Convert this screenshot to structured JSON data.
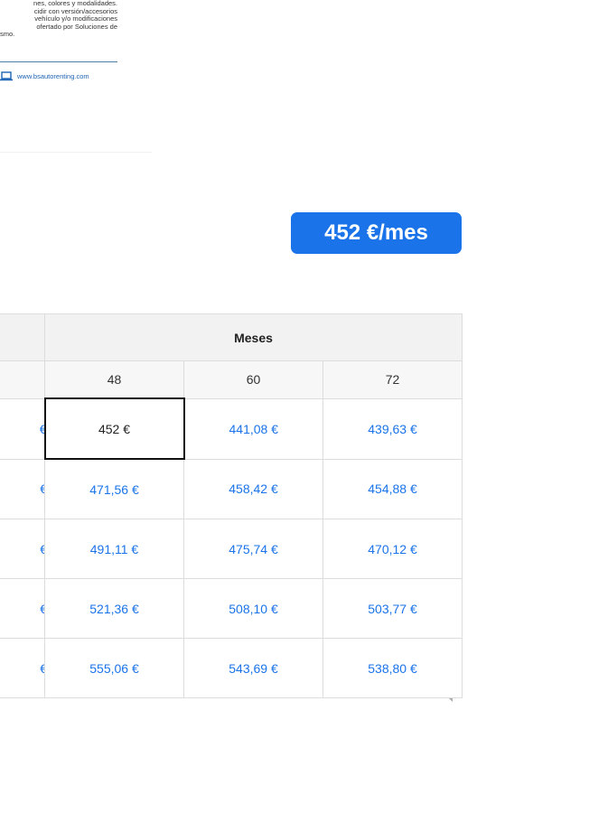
{
  "disclaimer": {
    "lines": [
      "nes, colores y modalidades.",
      "cidir con versión/accesorios",
      "vehículo y/o modificaciones",
      "ofertado por Soluciones de",
      "smo."
    ],
    "website": "www.bsautorenting.com"
  },
  "price_badge": "452 €/mes",
  "table": {
    "header": "Meses",
    "months": [
      "48",
      "60",
      "72"
    ],
    "rows": [
      {
        "first": "€",
        "cells": [
          "452 €",
          "441,08 €",
          "439,63 €"
        ]
      },
      {
        "first": "€",
        "cells": [
          "471,56 €",
          "458,42 €",
          "454,88 €"
        ]
      },
      {
        "first": "€",
        "cells": [
          "491,11 €",
          "475,74 €",
          "470,12 €"
        ]
      },
      {
        "first": "€",
        "cells": [
          "521,36 €",
          "508,10 €",
          "503,77 €"
        ]
      },
      {
        "first": "€",
        "cells": [
          "555,06 €",
          "543,69 €",
          "538,80 €"
        ]
      }
    ]
  },
  "colors": {
    "accent": "#1a73e8",
    "selected_border": "#111111",
    "header_bg": "#f2f2f2"
  }
}
